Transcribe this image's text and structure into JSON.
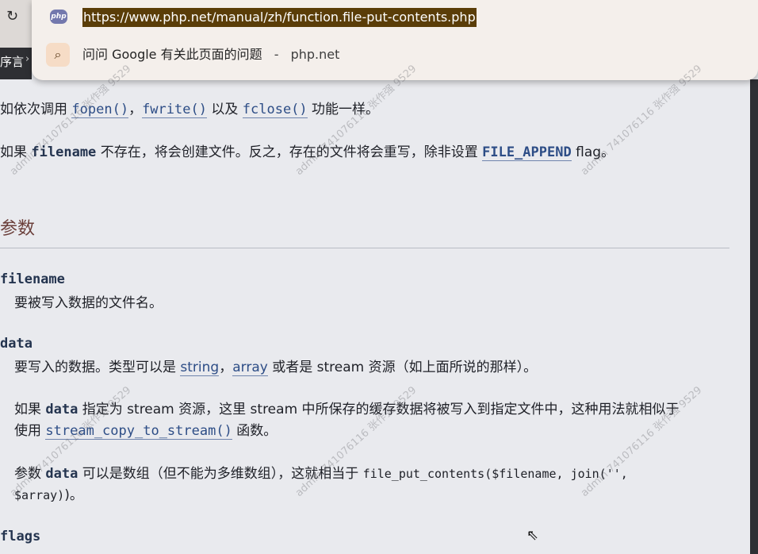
{
  "browser": {
    "url": "https://www.php.net/manual/zh/function.file-put-contents.php",
    "favicon_text": "php",
    "suggestion_text": "问问 Google 有关此页面的问题",
    "suggestion_separator": "-",
    "suggestion_domain": "php.net",
    "nav_text": "序言",
    "nav_chevron": "›"
  },
  "content": {
    "line1_prefix": "如依次调用 ",
    "fopen": "fopen()",
    "sep1": "，",
    "fwrite": "fwrite()",
    "line1_mid": " 以及 ",
    "fclose": "fclose()",
    "line1_suffix": " 功能一样。",
    "line2_prefix": "如果 ",
    "filename_kw": "filename",
    "line2_mid": " 不存在，将会创建文件。反之，存在的文件将会重写，除非设置 ",
    "file_append": "FILE_APPEND",
    "line2_suffix": " flag。",
    "section_title": "参数",
    "param1_name": "filename",
    "param1_desc": "要被写入数据的文件名。",
    "param2_name": "data",
    "param2_desc_prefix": "要写入的数据。类型可以是 ",
    "string_link": "string",
    "param2_sep": "，",
    "array_link": "array",
    "param2_desc_suffix": " 或者是 stream 资源（如上面所说的那样）。",
    "para3_prefix": "如果 ",
    "data_kw": "data",
    "para3_suffix": " 指定为 stream 资源，这里 stream 中所保存的缓存数据将被写入到指定文件中，这种用法就相似于",
    "para3_line2_prefix": "使用 ",
    "stream_copy": "stream_copy_to_stream()",
    "para3_line2_suffix": " 函数。",
    "para4_prefix": "参数 ",
    "para4_mid": " 可以是数组（但不能为多维数组），这就相当于 ",
    "para4_code": "file_put_contents($filename, join('',",
    "para4_code2": "$array)",
    "para4_end": ")。",
    "param3_name": "flags"
  },
  "watermark": "admin 741076116 张作强 9529"
}
